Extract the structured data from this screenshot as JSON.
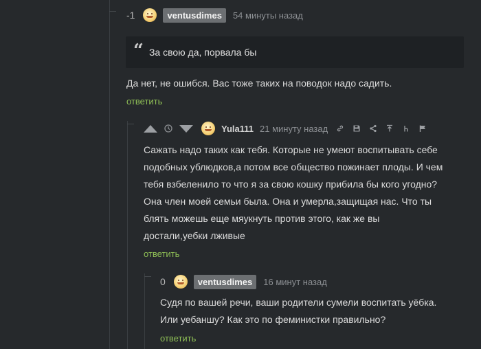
{
  "comments": [
    {
      "rating": "-1",
      "author": "ventusdimes",
      "time": "54 минуты назад",
      "quote": "За свою да, порвала бы",
      "text": "Да нет, не ошибся. Вас тоже таких на поводок надо садить.",
      "reply_label": "ответить"
    },
    {
      "author": "Yula111",
      "time": "21 минуту назад",
      "text_lines": [
        "Сажать надо таких как тебя. Которые не умеют воспитывать себе",
        "подобных ублюдков,а потом все общество пожинает плоды. И чем",
        "тебя взбеленило то что я за свою кошку прибила бы кого угодно?",
        "Она член моей семьи была. Она и умерла,защищая нас. Что ты",
        "блять можешь еще мяукнуть против этого, как же вы",
        "достали,уебки лживые"
      ],
      "reply_label": "ответить",
      "toolbar_icons": [
        "link-icon",
        "save-icon",
        "share-icon",
        "to-parent-icon",
        "thread-icon",
        "report-flag-icon"
      ]
    },
    {
      "rating": "0",
      "author": "ventusdimes",
      "time": "16 минут назад",
      "text_lines": [
        "Судя по вашей речи, ваши родители сумели воспитать уёбка.",
        "Или уебаншу? Как это по феминистки правильно?"
      ],
      "reply_label": "ответить"
    }
  ],
  "colors": {
    "background": "#26292c",
    "reply_link": "#8fbf56",
    "author_badge": "#6c6f72"
  }
}
